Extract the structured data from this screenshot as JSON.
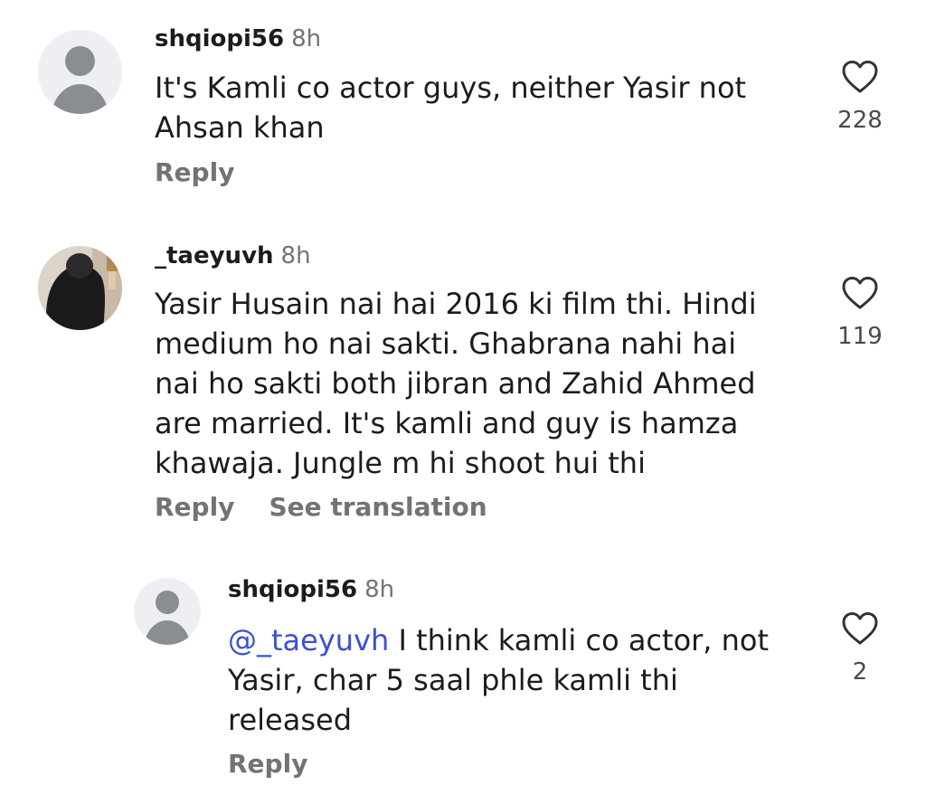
{
  "comments": [
    {
      "username": "shqiopi56",
      "time": "8h",
      "text": "It's Kamli co actor guys, neither Yasir not\nAhsan khan",
      "reply_label": "Reply",
      "likes": "228"
    },
    {
      "username": "_taeyuvh",
      "time": "8h",
      "text": "Yasir Husain nai hai 2016 ki film thi. Hindi\nmedium ho nai sakti. Ghabrana nahi hai\nnai ho sakti both jibran and Zahid Ahmed\nare married. It's kamli and guy is hamza\nkhawaja. Jungle m hi shoot hui thi",
      "reply_label": "Reply",
      "translate_label": "See translation",
      "likes": "119"
    },
    {
      "username": "shqiopi56",
      "time": "8h",
      "mention": "@_taeyuvh",
      "text": " I think kamli co actor, not\nYasir, char 5 saal phle kamli thi\nreleased",
      "reply_label": "Reply",
      "likes": "2"
    }
  ],
  "icons": {
    "like": "heart-outline-icon",
    "mention": "threads-at-icon",
    "avatar_default": "default-user-avatar"
  },
  "colors": {
    "text": "#1c1c1c",
    "muted": "#737373",
    "mention": "#3a4fd8",
    "avatar_bg": "#eeeff2",
    "avatar_fg": "#8a8e93"
  }
}
